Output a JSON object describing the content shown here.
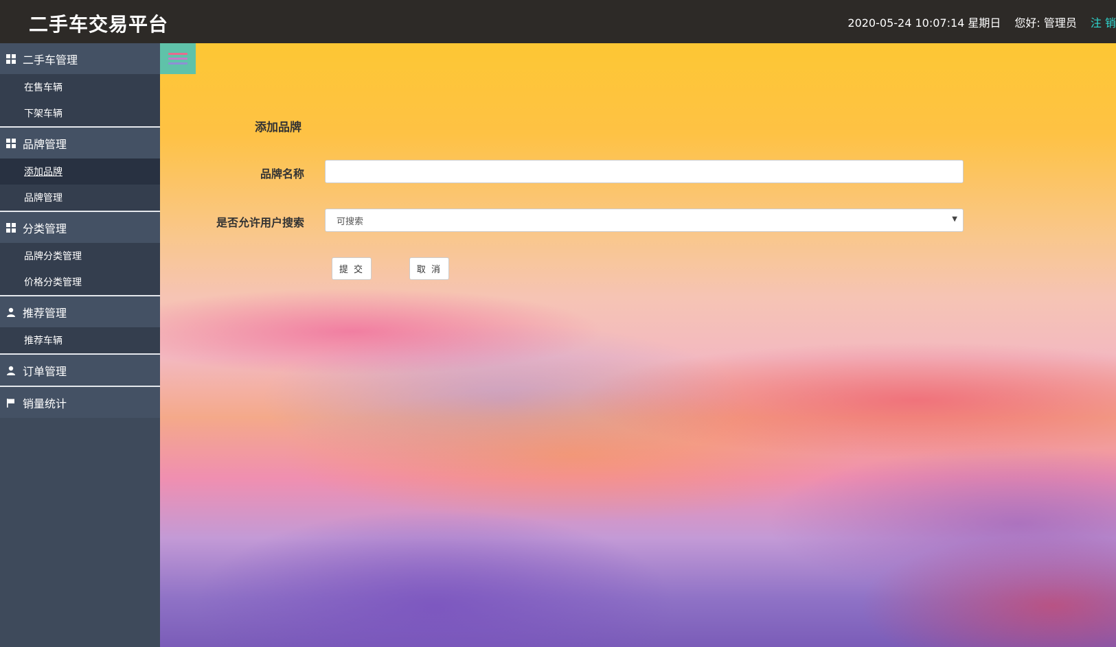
{
  "header": {
    "brand": "二手车交易平台",
    "datetime": "2020-05-24 10:07:14 星期日",
    "greeting": "您好: 管理员",
    "logout": "注 销"
  },
  "sidebar": {
    "groups": [
      {
        "title": "二手车管理",
        "icon": "grid-icon",
        "items": [
          "在售车辆",
          "下架车辆"
        ]
      },
      {
        "title": "品牌管理",
        "icon": "grid-icon",
        "items": [
          "添加品牌",
          "品牌管理"
        ],
        "active_item": "添加品牌"
      },
      {
        "title": "分类管理",
        "icon": "grid-icon",
        "items": [
          "品牌分类管理",
          "价格分类管理"
        ]
      },
      {
        "title": "推荐管理",
        "icon": "user-icon",
        "items": [
          "推荐车辆"
        ]
      },
      {
        "title": "订单管理",
        "icon": "user-icon",
        "items": []
      },
      {
        "title": "销量统计",
        "icon": "flag-icon",
        "items": []
      }
    ]
  },
  "form": {
    "title": "添加品牌",
    "name_label": "品牌名称",
    "name_value": "",
    "search_label": "是否允许用户搜索",
    "search_selected": "可搜索",
    "submit_label": "提 交",
    "cancel_label": "取 消"
  },
  "colors": {
    "header_bg": "#2d2a27",
    "sidebar_bg": "#3e4a5b",
    "toggle_bg": "#5fc2a9",
    "logout": "#2fd8d0"
  }
}
